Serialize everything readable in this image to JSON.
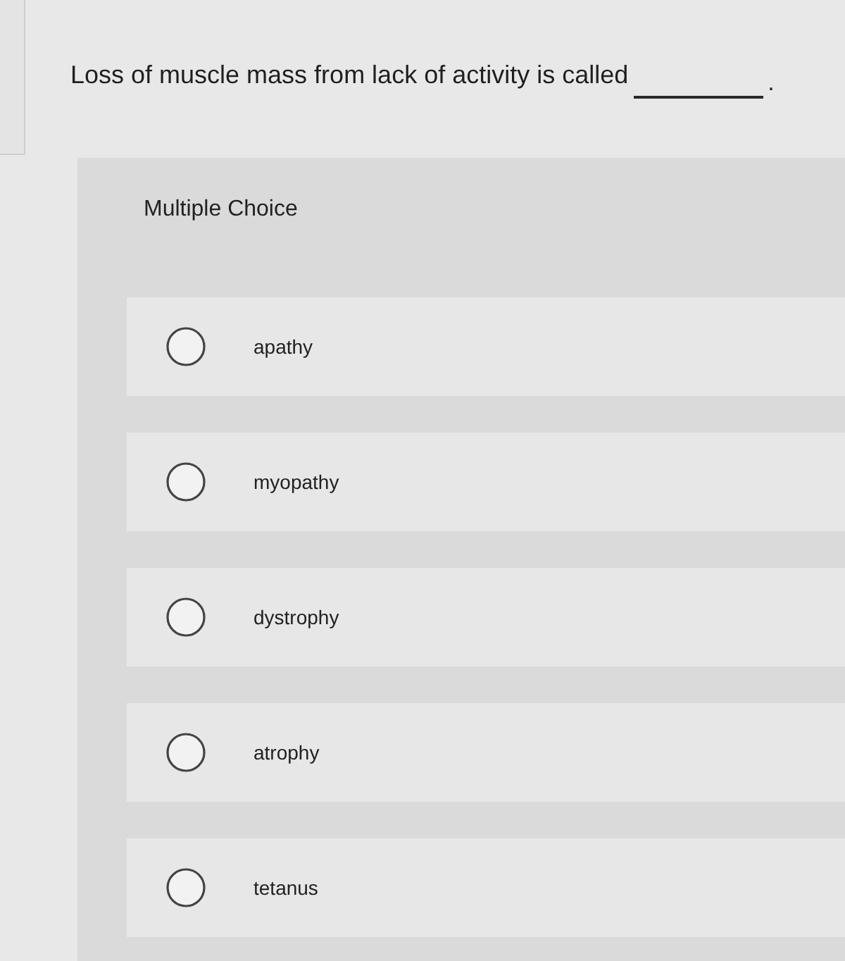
{
  "question": {
    "text": "Loss of muscle mass from lack of activity is called",
    "end": "."
  },
  "section": {
    "title": "Multiple Choice"
  },
  "options": [
    {
      "label": "apathy",
      "selected": false
    },
    {
      "label": "myopathy",
      "selected": false
    },
    {
      "label": "dystrophy",
      "selected": false
    },
    {
      "label": "atrophy",
      "selected": false
    },
    {
      "label": "tetanus",
      "selected": false
    }
  ]
}
